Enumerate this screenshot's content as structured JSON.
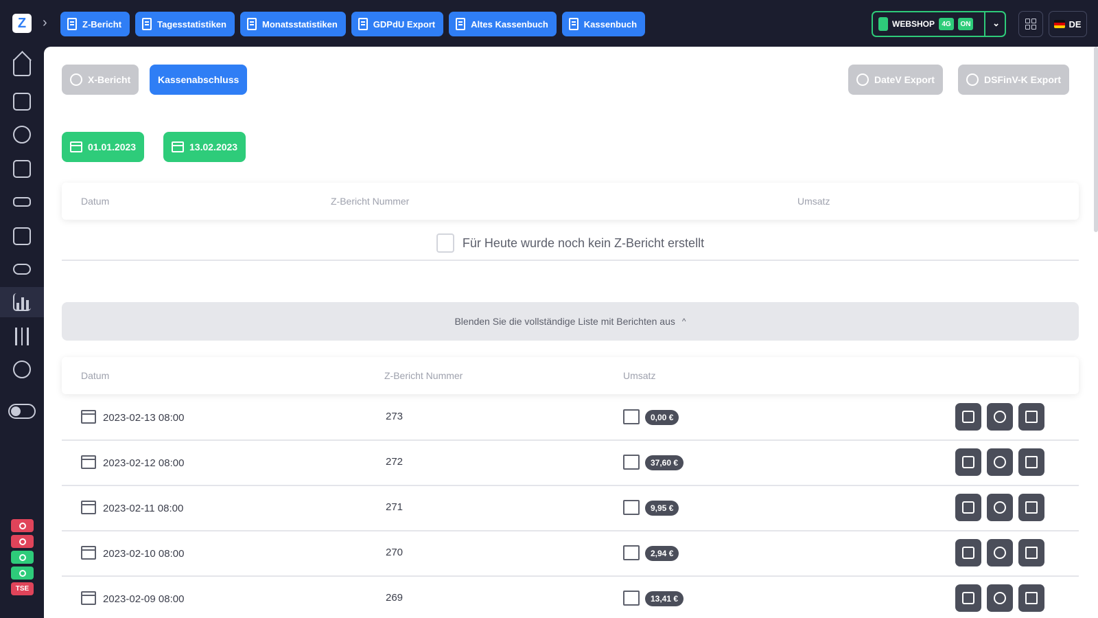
{
  "topbar": {
    "logo_letter": "Z",
    "tabs": [
      {
        "label": "Z-Bericht"
      },
      {
        "label": "Tagesstatistiken"
      },
      {
        "label": "Monatsstatistiken"
      },
      {
        "label": "GDPdU Export"
      },
      {
        "label": "Altes Kassenbuch"
      },
      {
        "label": "Kassenbuch"
      }
    ],
    "webshop_label": "WEBSHOP",
    "webshop_badge_1": "4G",
    "webshop_badge_2": "ON",
    "language": "DE"
  },
  "sidebar": {
    "status_badge": "TSE"
  },
  "actions": {
    "x_report": "X-Bericht",
    "close_register": "Kassenabschluss",
    "datev_export": "DateV Export",
    "dsfinvk_export": "DSFinV-K Export"
  },
  "date_range": {
    "from": "01.01.2023",
    "to": "13.02.2023"
  },
  "today_table": {
    "columns": [
      "Datum",
      "Z-Bericht Nummer",
      "Umsatz"
    ],
    "empty_message": "Für Heute wurde noch kein Z-Bericht erstellt"
  },
  "toggle_list_label": "Blenden Sie die vollständige Liste mit Berichten aus",
  "reports_table": {
    "columns": [
      "Datum",
      "Z-Bericht Nummer",
      "Umsatz"
    ],
    "rows": [
      {
        "date": "2023-02-13 08:00",
        "number": "273",
        "amount": "0,00 €"
      },
      {
        "date": "2023-02-12 08:00",
        "number": "272",
        "amount": "37,60 €"
      },
      {
        "date": "2023-02-11 08:00",
        "number": "271",
        "amount": "9,95 €"
      },
      {
        "date": "2023-02-10 08:00",
        "number": "270",
        "amount": "2,94 €"
      },
      {
        "date": "2023-02-09 08:00",
        "number": "269",
        "amount": "13,41 €"
      }
    ]
  },
  "colors": {
    "primary": "#2f7ef5",
    "success": "#2ecc7a",
    "sidebar_bg": "#1b1d2e",
    "danger": "#e0445a"
  }
}
